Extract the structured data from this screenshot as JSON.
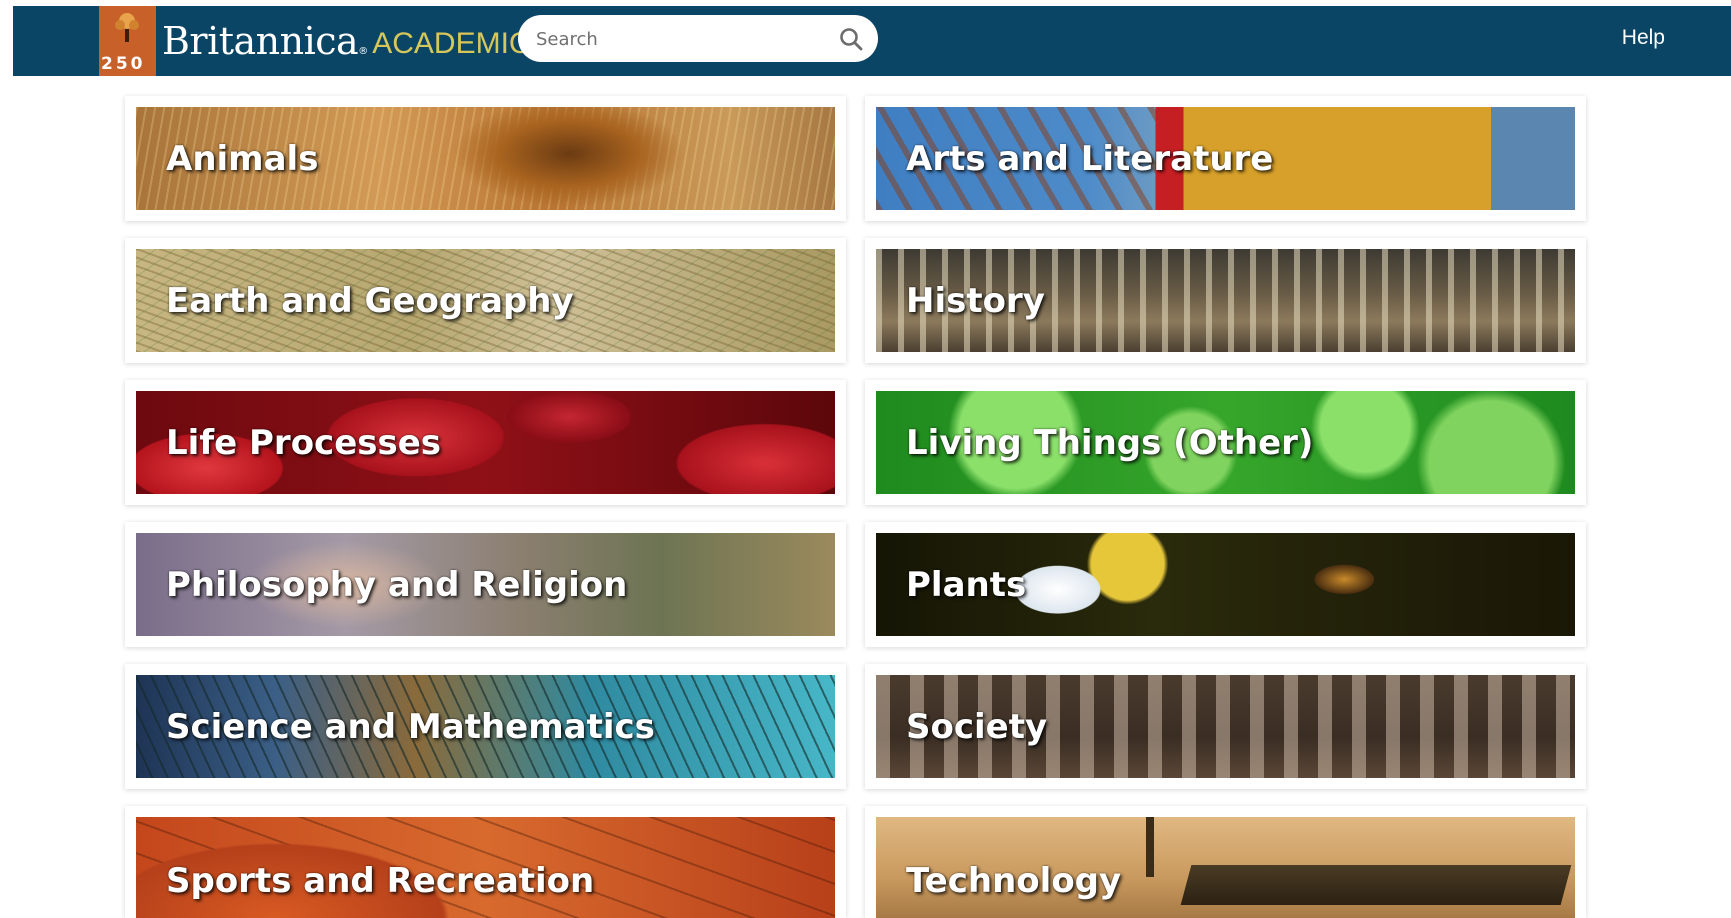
{
  "header": {
    "logo": {
      "badge_number": "250",
      "brand_name": "Britannica",
      "registered_mark": "®",
      "product_name": "ACADEMIC"
    },
    "search": {
      "placeholder": "Search",
      "value": ""
    },
    "help_label": "Help",
    "colors": {
      "bar": "#0b4566",
      "academic": "#d6c75a"
    }
  },
  "categories": [
    {
      "label": "Animals"
    },
    {
      "label": "Arts and Literature"
    },
    {
      "label": "Earth and Geography"
    },
    {
      "label": "History"
    },
    {
      "label": "Life Processes"
    },
    {
      "label": "Living Things (Other)"
    },
    {
      "label": "Philosophy and Religion"
    },
    {
      "label": "Plants"
    },
    {
      "label": "Science and Mathematics"
    },
    {
      "label": "Society"
    },
    {
      "label": "Sports and Recreation"
    },
    {
      "label": "Technology"
    }
  ]
}
